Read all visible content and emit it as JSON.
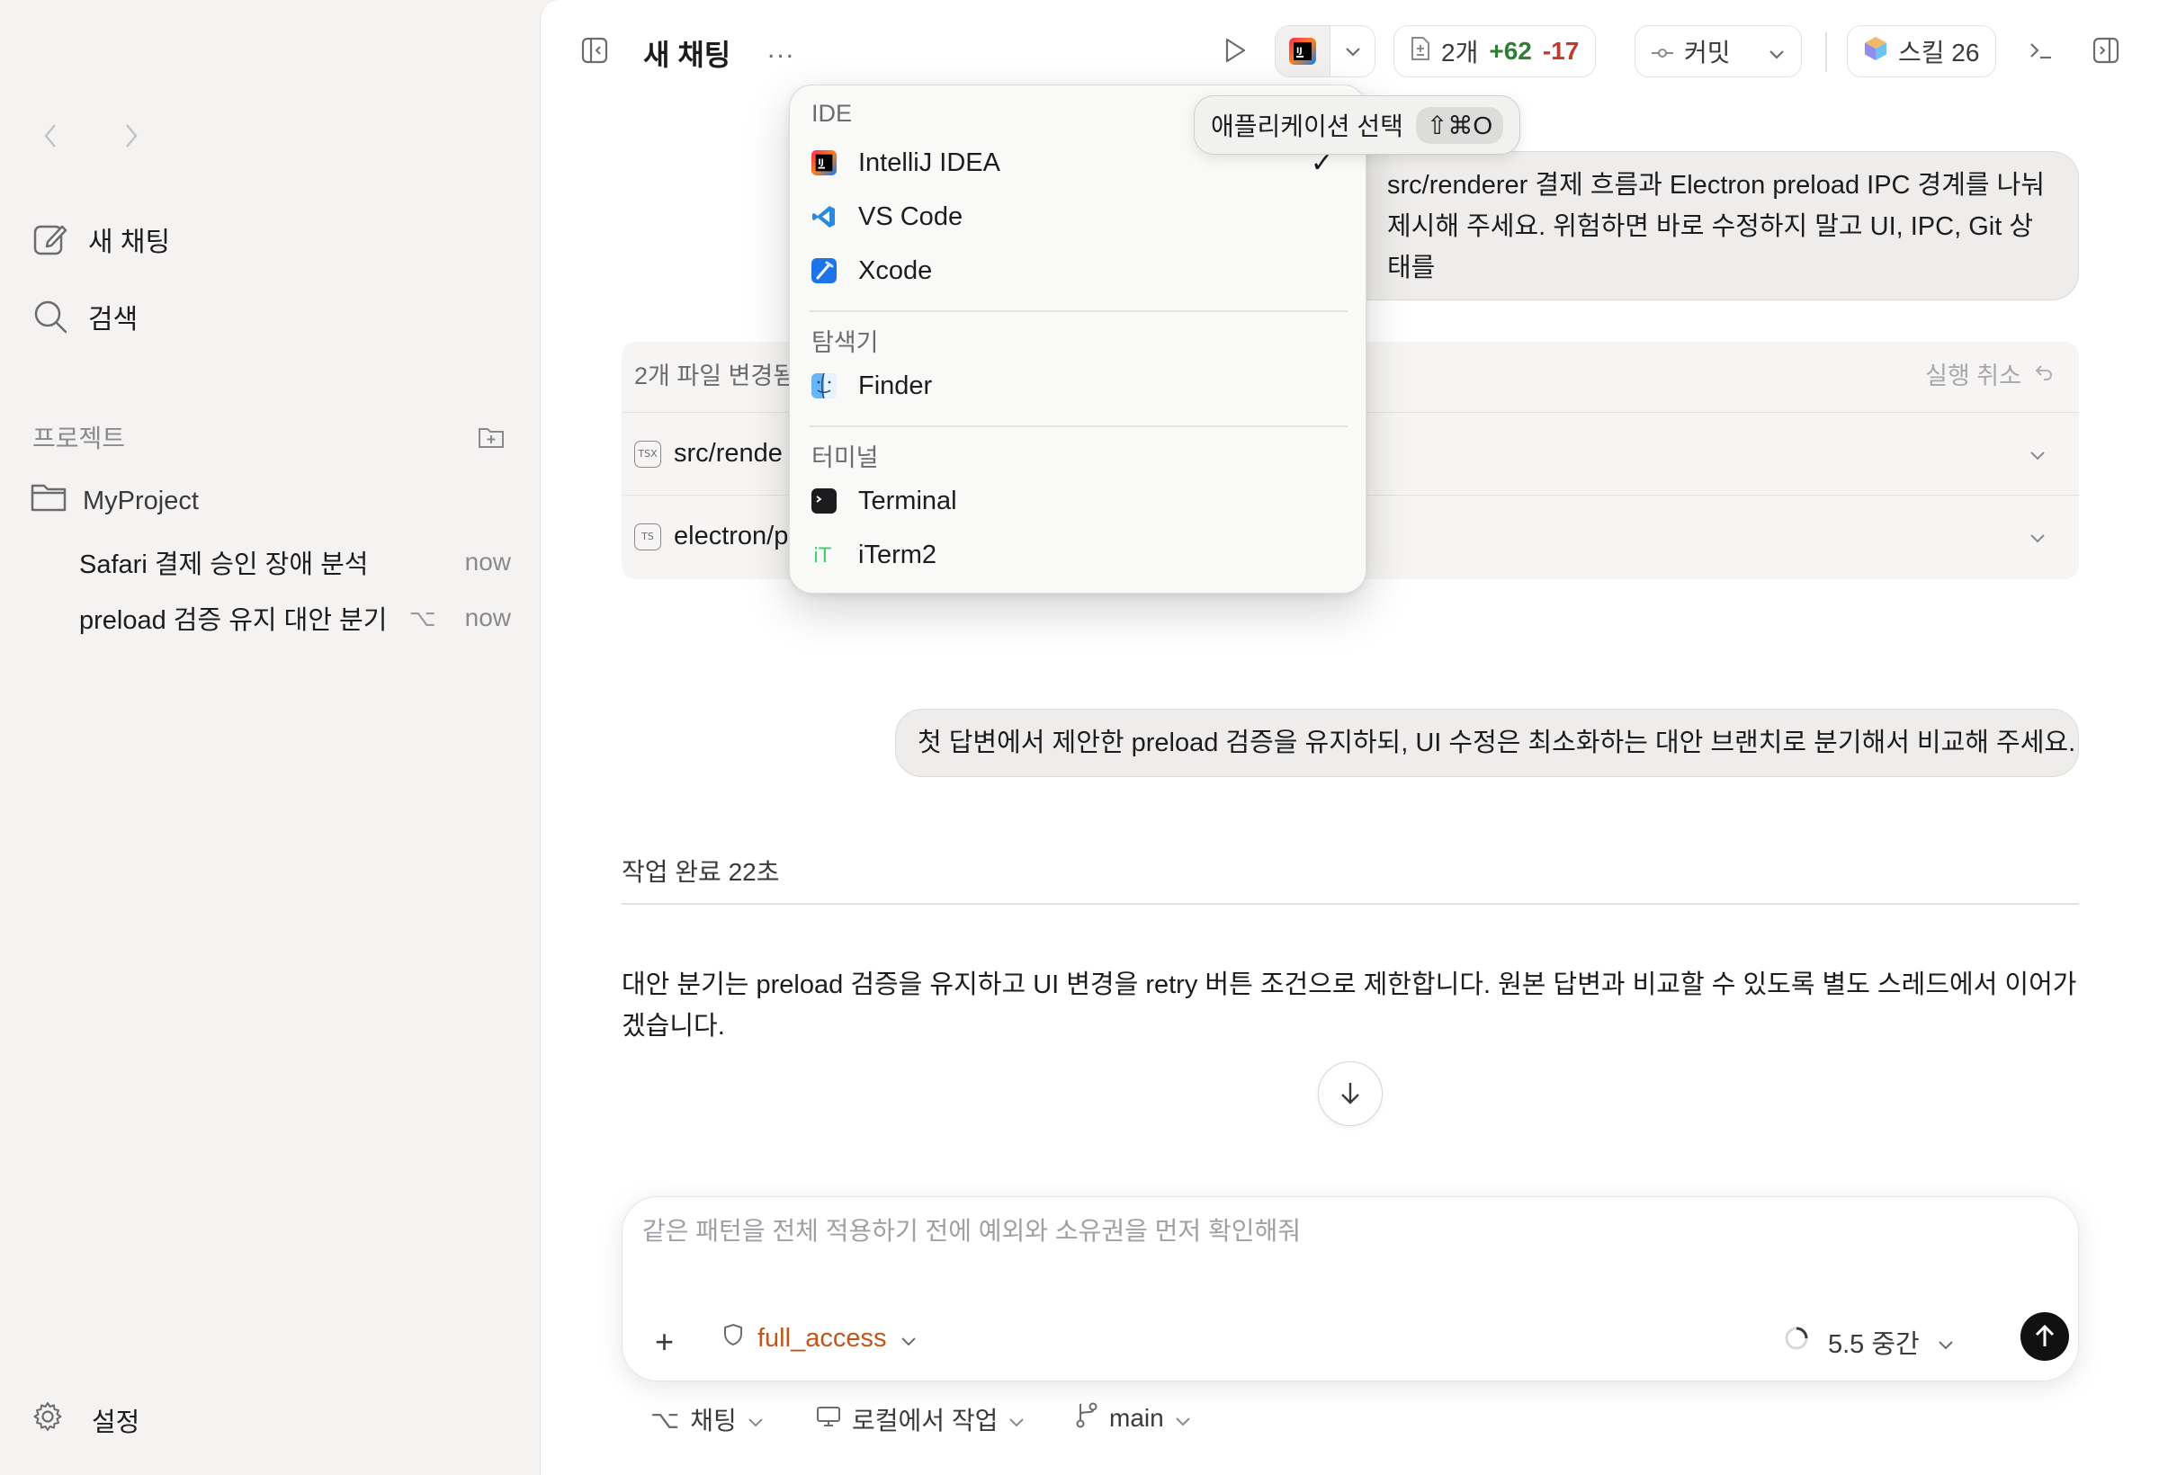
{
  "sidebar": {
    "new_chat": "새 채팅",
    "search": "검색",
    "projects_label": "프로젝트",
    "project_name": "MyProject",
    "threads": [
      {
        "title": "Safari 결제 승인 장애 분석",
        "option": "",
        "time": "now"
      },
      {
        "title": "preload 검증 유지 대안 분기",
        "option": "⌥",
        "time": "now"
      }
    ],
    "settings": "설정"
  },
  "toolbar": {
    "title": "새 채팅",
    "more": "...",
    "diff_count": "2개",
    "diff_plus": "+62",
    "diff_minus": "-17",
    "commit": "커밋",
    "skills": "스킬 26"
  },
  "chat": {
    "user_message_1_line1": "src/renderer 결제 흐름과 Electron preload IPC 경계를 나눠",
    "user_message_1_line2": "제시해 주세요. 위험하면 바로 수정하지 말고 UI, IPC, Git 상태를",
    "changes_header": "2개 파일 변경됨",
    "undo": "실행 취소",
    "files": [
      {
        "badge": "TSX",
        "path": "src/rende"
      },
      {
        "badge": "TS",
        "path": "electron/p"
      }
    ],
    "user_message_2": "첫 답변에서 제안한 preload 검증을 유지하되, UI 수정은 최소화하는 대안 브랜치로 분기해서 비교해 주세요.",
    "done_label": "작업 완료 22초",
    "answer": "대안 분기는 preload 검증을 유지하고 UI 변경을 retry 버튼 조건으로 제한합니다. 원본 답변과 비교할 수 있도록 별도 스레드에서 이어가겠습니다."
  },
  "composer": {
    "placeholder": "같은 패턴을 전체 적용하기 전에 예외와 소유권을 먼저 확인해줘",
    "add": "+",
    "access": "full_access",
    "model": "5.5 중간"
  },
  "bottom": {
    "mode": "채팅",
    "location": "로컬에서 작업",
    "branch": "main"
  },
  "menu": {
    "groups": [
      {
        "label": "IDE",
        "items": [
          {
            "label": "IntelliJ IDEA",
            "icon": "intellij-icon",
            "checked": true
          },
          {
            "label": "VS Code",
            "icon": "vscode-icon"
          },
          {
            "label": "Xcode",
            "icon": "xcode-icon"
          }
        ]
      },
      {
        "label": "탐색기",
        "items": [
          {
            "label": "Finder",
            "icon": "finder-icon"
          }
        ]
      },
      {
        "label": "터미널",
        "items": [
          {
            "label": "Terminal",
            "icon": "terminal-icon"
          },
          {
            "label": "iTerm2",
            "icon": "iterm2-icon"
          }
        ]
      }
    ],
    "check": "✓"
  },
  "tooltip": {
    "label": "애플리케이션 선택",
    "shortcut": "⇧⌘O"
  },
  "colors": {
    "accent_plus": "#2e7d32",
    "accent_minus": "#c0392b",
    "access": "#c0571a"
  }
}
